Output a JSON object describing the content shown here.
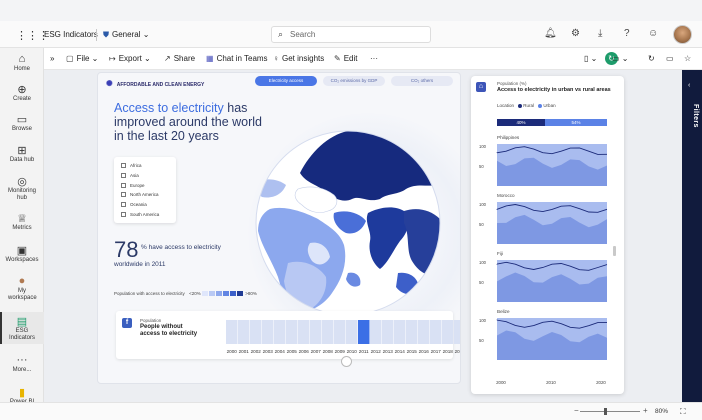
{
  "app": {
    "title": "ESG Indicators",
    "workspace": "General",
    "search_placeholder": "Search"
  },
  "nav": [
    {
      "label": "Home",
      "icon": "home-icon",
      "glyph": "⌂"
    },
    {
      "label": "Create",
      "icon": "create-icon",
      "glyph": "⊕"
    },
    {
      "label": "Browse",
      "icon": "browse-icon",
      "glyph": "▭"
    },
    {
      "label": "Data hub",
      "icon": "data-hub-icon",
      "glyph": "⊞"
    },
    {
      "label": "Monitoring hub",
      "icon": "monitoring-hub-icon",
      "glyph": "◎"
    },
    {
      "label": "Metrics",
      "icon": "metrics-icon",
      "glyph": "♕"
    },
    {
      "label": "Workspaces",
      "icon": "workspaces-icon",
      "glyph": "▣"
    },
    {
      "label": "My workspace",
      "icon": "my-workspace-icon",
      "glyph": "●"
    },
    {
      "label": "ESG Indicators",
      "icon": "esg-indicators-icon",
      "glyph": "▤"
    },
    {
      "label": "More...",
      "icon": "more-icon",
      "glyph": "···"
    },
    {
      "label": "Power BI",
      "icon": "power-bi-icon",
      "glyph": "▮"
    }
  ],
  "commands": {
    "expand": "»",
    "file": "File",
    "export": "Export",
    "share": "Share",
    "chat": "Chat in Teams",
    "insights": "Get insights",
    "edit": "Edit",
    "more": "···"
  },
  "report": {
    "header": "AFFORDABLE AND CLEAN ENERGY",
    "tabs": [
      "Electricity access",
      "CO₂ emissions by GDP",
      "CO₂ others"
    ],
    "headline_highlight": "Access to electricity",
    "headline_rest": " has improved around the world in the last 20 years",
    "regions": [
      "Africa",
      "Asia",
      "Europe",
      "North America",
      "Oceania",
      "South America"
    ],
    "stat_value": "78",
    "stat_text": "% have access to electricity",
    "stat_sub": "worldwide in 2011",
    "legend_label": "Population with access to electricity",
    "legend_low": "<20%",
    "legend_high": ">80%",
    "legend_colors": [
      "#dfe6fb",
      "#b9c9f4",
      "#8ea8ec",
      "#6285e3",
      "#3b5fc9",
      "#203b94"
    ],
    "card_title": "Population",
    "card_main": "People without access to electricity",
    "years": [
      "2000",
      "2001",
      "2002",
      "2003",
      "2004",
      "2005",
      "2006",
      "2007",
      "2008",
      "2009",
      "2010",
      "2011",
      "2012",
      "2013",
      "2014",
      "2015",
      "2016",
      "2017",
      "2018",
      "2019"
    ],
    "selected_year": "2011"
  },
  "side": {
    "subtitle": "Population (%)",
    "title": "Access to electricity in urban vs rural areas",
    "location_label": "Location",
    "rural": "Rural",
    "urban": "Urban",
    "rural_color": "#1c2b7a",
    "urban_color": "#5b82e6",
    "share_left": "40%",
    "share_right": "54%",
    "countries": [
      {
        "name": "Philippines",
        "yticks": [
          "100",
          "50"
        ]
      },
      {
        "name": "Morocco",
        "yticks": [
          "100",
          "50"
        ]
      },
      {
        "name": "Fiji",
        "yticks": [
          "100",
          "50"
        ]
      },
      {
        "name": "Belize",
        "yticks": [
          "100",
          "50"
        ]
      }
    ],
    "xticks": [
      "2000",
      "2010",
      "2020"
    ]
  },
  "filters": {
    "label": "Filters"
  },
  "status": {
    "zoom": "80%"
  }
}
